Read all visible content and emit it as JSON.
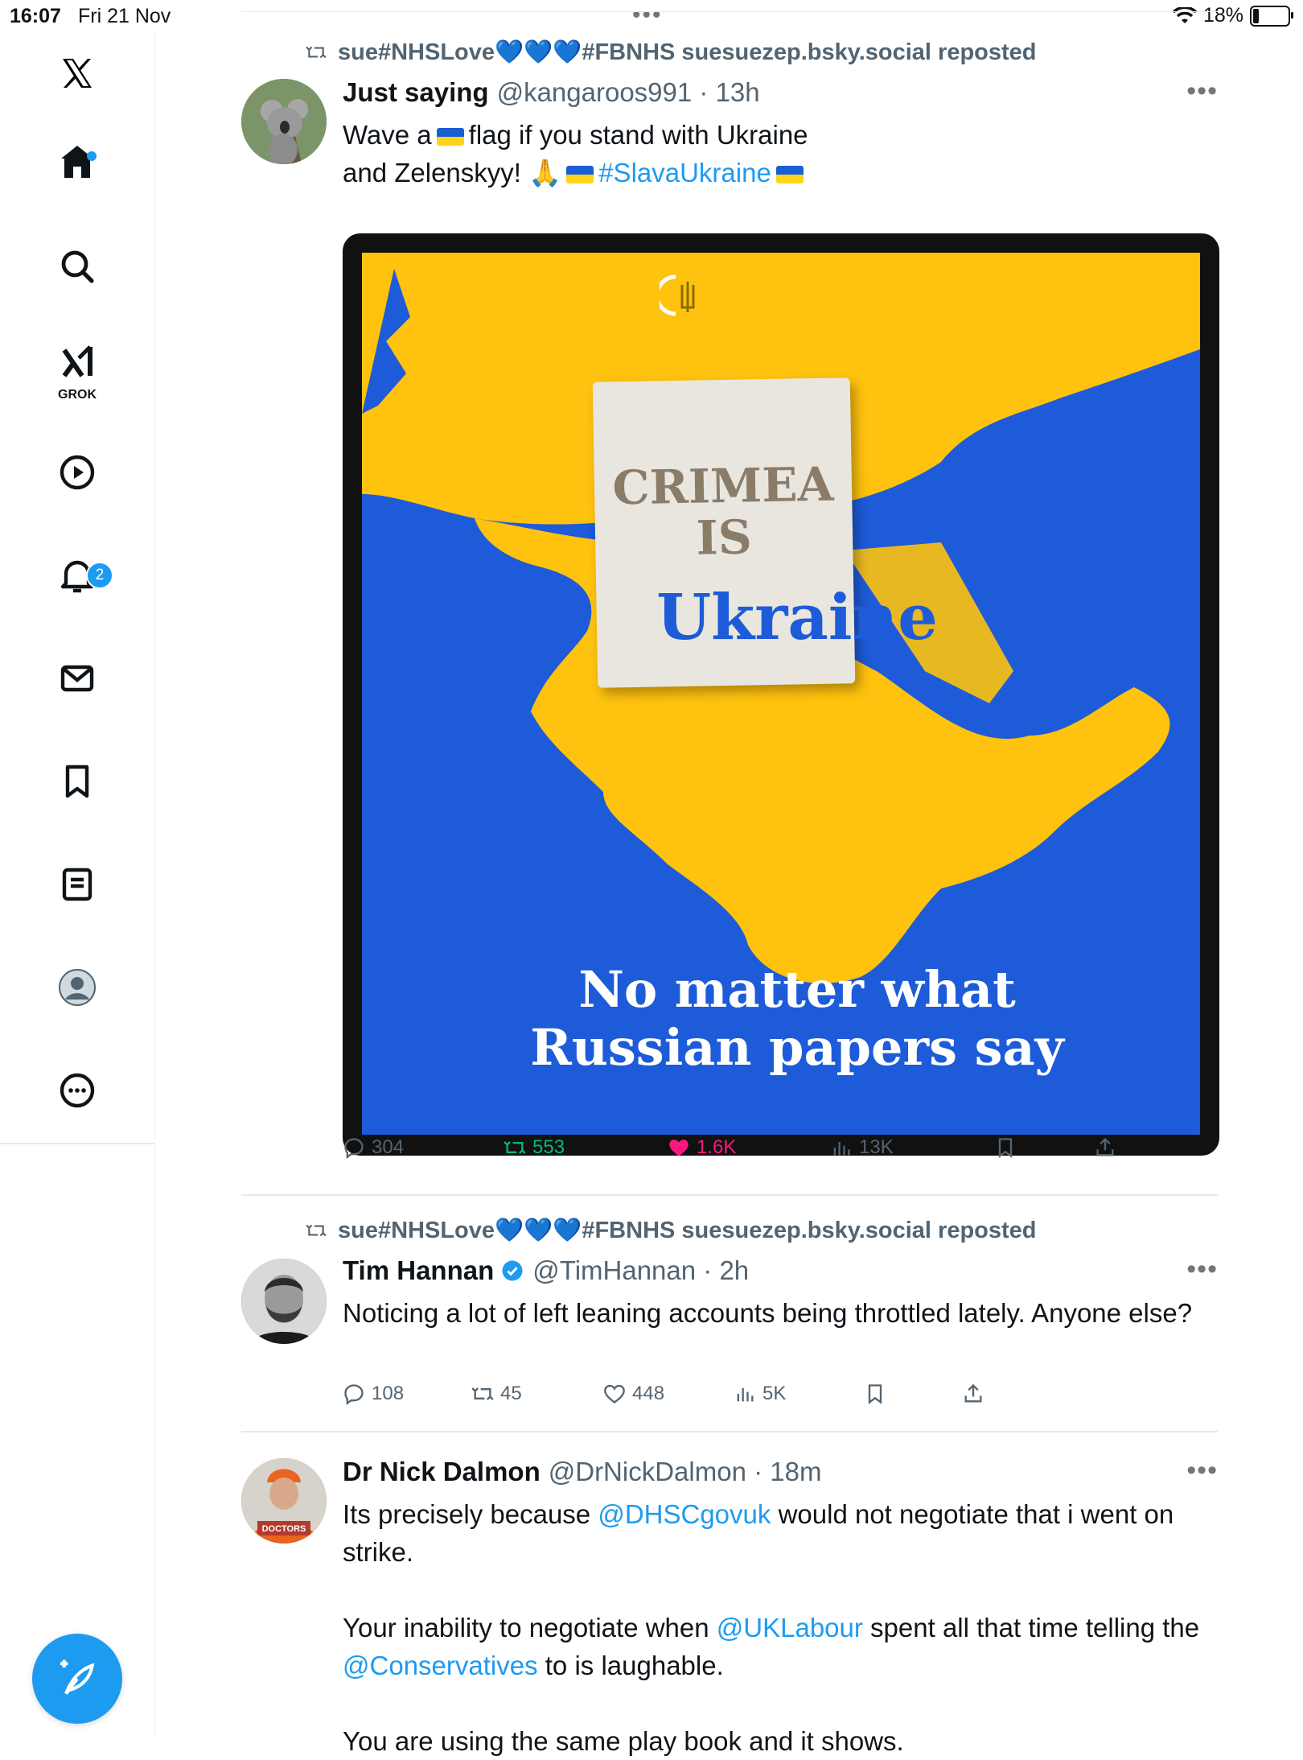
{
  "status_bar": {
    "time": "16:07",
    "date": "Fri 21 Nov",
    "battery": "18%"
  },
  "sidebar": {
    "grok_label": "GROK",
    "notifications_badge": "2"
  },
  "posts": [
    {
      "repost_label": "sue#NHSLove💙💙💙#FBNHS suesuezep.bsky.social reposted",
      "name": "Just saying",
      "handle": "@kangaroos991 · 13h",
      "text_line1_a": "Wave a",
      "text_line1_b": "flag if you stand with Ukraine",
      "text_line2_a": "and Zelenskyy! 🙏",
      "text_hashtag": "#SlavaUkraine",
      "image": {
        "headline": "CRIMEA IS",
        "headline_line1": "CRIMEA",
        "headline_line2": "IS",
        "center_word": "Ukraine",
        "bottom_line1": "No matter what",
        "bottom_line2": "Russian papers say"
      },
      "stats": {
        "replies": "304",
        "reposts": "553",
        "likes": "1.6K",
        "views": "13K"
      }
    },
    {
      "repost_label": "sue#NHSLove💙💙💙#FBNHS suesuezep.bsky.social reposted",
      "name": "Tim Hannan",
      "handle": "@TimHannan · 2h",
      "text": "Noticing a lot of left leaning accounts being throttled lately. Anyone else?",
      "stats": {
        "replies": "108",
        "reposts": "45",
        "likes": "448",
        "views": "5K"
      }
    },
    {
      "name": "Dr Nick Dalmon",
      "handle": "@DrNickDalmon · 18m",
      "p1_a": "Its precisely because ",
      "p1_link": "@DHSCgovuk",
      "p1_b": " would not negotiate that i went on strike.",
      "p2_a": "Your inability to negotiate when ",
      "p2_link1": "@UKLabour",
      "p2_b": " spent all that time telling the ",
      "p2_link2": "@Conservatives",
      "p2_c": " to is laughable.",
      "p3": "You are using the same play book and it shows."
    }
  ],
  "colors": {
    "accent": "#1d9bf0",
    "repost_green": "#00ba7c",
    "like_pink": "#f91880",
    "ukraine_blue": "#1d5bd8",
    "ukraine_yellow": "#ffc20e"
  }
}
